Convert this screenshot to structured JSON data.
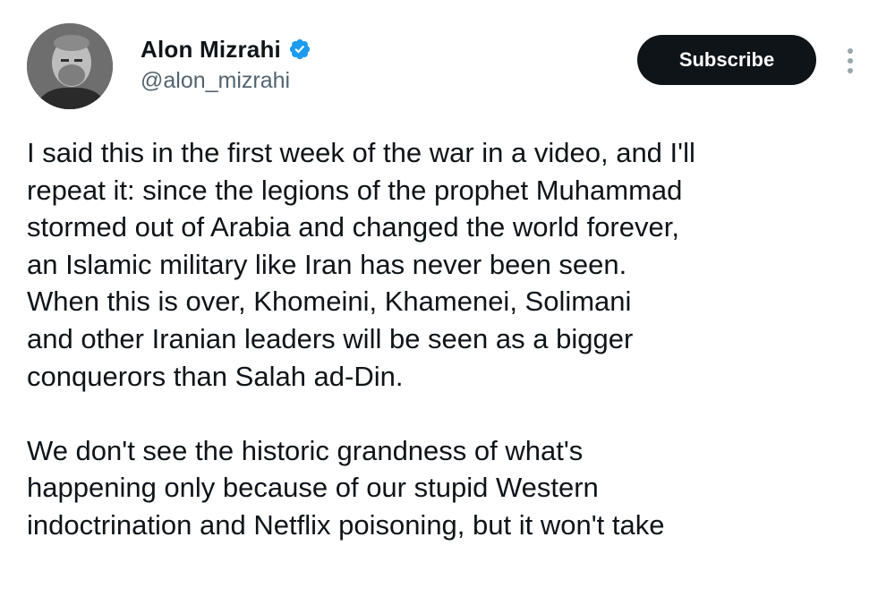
{
  "author": {
    "display_name": "Alon Mizrahi",
    "handle": "@alon_mizrahi",
    "verified": true,
    "avatar_icon": "user-avatar-photo"
  },
  "actions": {
    "subscribe_label": "Subscribe",
    "more_icon": "more-vertical-icon"
  },
  "tweet": {
    "paragraph_1": [
      "I said this in the first week of the war in a video, and I'll",
      "repeat it: since the legions of the prophet Muhammad",
      "stormed out of Arabia and changed the world forever,",
      "an Islamic military like Iran has never been seen.",
      "When this is over, Khomeini, Khamenei, Solimani",
      "and other Iranian leaders will be seen as a bigger",
      "conquerors than Salah ad-Din."
    ],
    "paragraph_2": [
      "We don't see the historic grandness of what's",
      "happening only because of our stupid Western",
      "indoctrination and Netflix poisoning, but it won't take"
    ]
  },
  "colors": {
    "text_primary": "#0f1419",
    "text_secondary": "#536471",
    "verified_blue": "#1d9bf0",
    "button_bg": "#0f1419"
  }
}
